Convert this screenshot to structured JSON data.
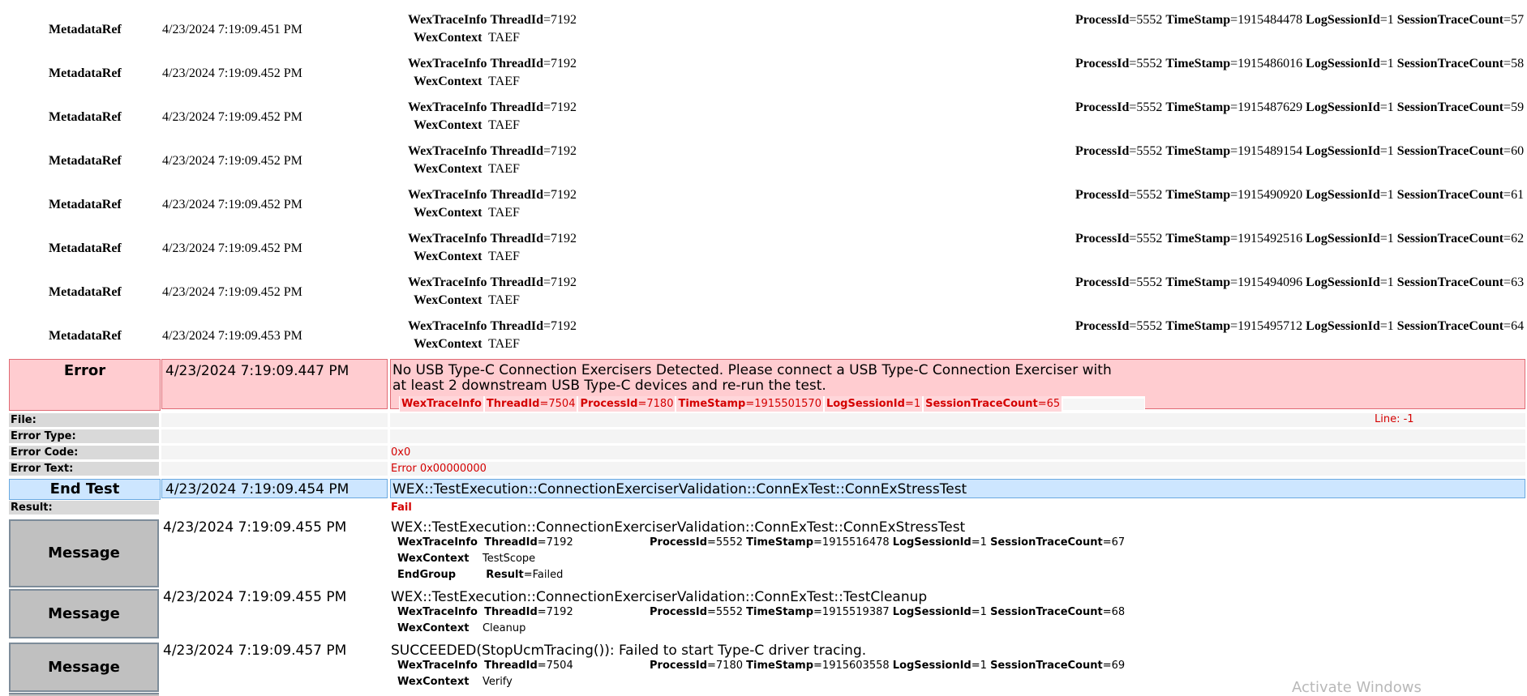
{
  "metadata_rows": [
    {
      "label": "MetadataRef",
      "time": "4/23/2024 7:19:09.451 PM",
      "wti_key": "WexTraceInfo",
      "thread_key": "ThreadId",
      "thread_val": "=7192",
      "ctx_key": "WexContext",
      "ctx_val": "TAEF",
      "pid_key": "ProcessId",
      "pid_val": "=5552",
      "ts_key": "TimeStamp",
      "ts_val": "=1915484478",
      "ls_key": "LogSessionId",
      "ls_val": "=1",
      "stc_key": "SessionTraceCount",
      "stc_val": "=57"
    },
    {
      "label": "MetadataRef",
      "time": "4/23/2024 7:19:09.452 PM",
      "wti_key": "WexTraceInfo",
      "thread_key": "ThreadId",
      "thread_val": "=7192",
      "ctx_key": "WexContext",
      "ctx_val": "TAEF",
      "pid_key": "ProcessId",
      "pid_val": "=5552",
      "ts_key": "TimeStamp",
      "ts_val": "=1915486016",
      "ls_key": "LogSessionId",
      "ls_val": "=1",
      "stc_key": "SessionTraceCount",
      "stc_val": "=58"
    },
    {
      "label": "MetadataRef",
      "time": "4/23/2024 7:19:09.452 PM",
      "wti_key": "WexTraceInfo",
      "thread_key": "ThreadId",
      "thread_val": "=7192",
      "ctx_key": "WexContext",
      "ctx_val": "TAEF",
      "pid_key": "ProcessId",
      "pid_val": "=5552",
      "ts_key": "TimeStamp",
      "ts_val": "=1915487629",
      "ls_key": "LogSessionId",
      "ls_val": "=1",
      "stc_key": "SessionTraceCount",
      "stc_val": "=59"
    },
    {
      "label": "MetadataRef",
      "time": "4/23/2024 7:19:09.452 PM",
      "wti_key": "WexTraceInfo",
      "thread_key": "ThreadId",
      "thread_val": "=7192",
      "ctx_key": "WexContext",
      "ctx_val": "TAEF",
      "pid_key": "ProcessId",
      "pid_val": "=5552",
      "ts_key": "TimeStamp",
      "ts_val": "=1915489154",
      "ls_key": "LogSessionId",
      "ls_val": "=1",
      "stc_key": "SessionTraceCount",
      "stc_val": "=60"
    },
    {
      "label": "MetadataRef",
      "time": "4/23/2024 7:19:09.452 PM",
      "wti_key": "WexTraceInfo",
      "thread_key": "ThreadId",
      "thread_val": "=7192",
      "ctx_key": "WexContext",
      "ctx_val": "TAEF",
      "pid_key": "ProcessId",
      "pid_val": "=5552",
      "ts_key": "TimeStamp",
      "ts_val": "=1915490920",
      "ls_key": "LogSessionId",
      "ls_val": "=1",
      "stc_key": "SessionTraceCount",
      "stc_val": "=61"
    },
    {
      "label": "MetadataRef",
      "time": "4/23/2024 7:19:09.452 PM",
      "wti_key": "WexTraceInfo",
      "thread_key": "ThreadId",
      "thread_val": "=7192",
      "ctx_key": "WexContext",
      "ctx_val": "TAEF",
      "pid_key": "ProcessId",
      "pid_val": "=5552",
      "ts_key": "TimeStamp",
      "ts_val": "=1915492516",
      "ls_key": "LogSessionId",
      "ls_val": "=1",
      "stc_key": "SessionTraceCount",
      "stc_val": "=62"
    },
    {
      "label": "MetadataRef",
      "time": "4/23/2024 7:19:09.452 PM",
      "wti_key": "WexTraceInfo",
      "thread_key": "ThreadId",
      "thread_val": "=7192",
      "ctx_key": "WexContext",
      "ctx_val": "TAEF",
      "pid_key": "ProcessId",
      "pid_val": "=5552",
      "ts_key": "TimeStamp",
      "ts_val": "=1915494096",
      "ls_key": "LogSessionId",
      "ls_val": "=1",
      "stc_key": "SessionTraceCount",
      "stc_val": "=63"
    },
    {
      "label": "MetadataRef",
      "time": "4/23/2024 7:19:09.453 PM",
      "wti_key": "WexTraceInfo",
      "thread_key": "ThreadId",
      "thread_val": "=7192",
      "ctx_key": "WexContext",
      "ctx_val": "TAEF",
      "pid_key": "ProcessId",
      "pid_val": "=5552",
      "ts_key": "TimeStamp",
      "ts_val": "=1915495712",
      "ls_key": "LogSessionId",
      "ls_val": "=1",
      "stc_key": "SessionTraceCount",
      "stc_val": "=64"
    }
  ],
  "error": {
    "label": "Error",
    "time": "4/23/2024 7:19:09.447 PM",
    "message": "No USB Type-C Connection Exercisers Detected. Please connect a USB Type-C Connection Exerciser with at least 2 downstream USB Type-C devices and re-run the test.",
    "trace": {
      "wti": "WexTraceInfo",
      "thread_key": "ThreadId",
      "thread_val": "=7504",
      "pid_key": "ProcessId",
      "pid_val": "=7180",
      "ts_key": "TimeStamp",
      "ts_val": "=1915501570",
      "ls_key": "LogSessionId",
      "ls_val": "=1",
      "stc_key": "SessionTraceCount",
      "stc_val": "=65"
    },
    "file_label": "File:",
    "line_text": "Line: -1",
    "type_label": "Error Type:",
    "code_label": "Error Code:",
    "code_value": "0x0",
    "text_label": "Error Text:",
    "text_value": "Error 0x00000000"
  },
  "end_test": {
    "label": "End Test",
    "time": "4/23/2024 7:19:09.454 PM",
    "name": "WEX::TestExecution::ConnectionExerciserValidation::ConnExTest::ConnExStressTest",
    "result_label": "Result:",
    "result_value": "Fail"
  },
  "messages": [
    {
      "label": "Message",
      "time": "4/23/2024 7:19:09.455 PM",
      "title": "WEX::TestExecution::ConnectionExerciserValidation::ConnExTest::ConnExStressTest",
      "wti": "WexTraceInfo",
      "thread_key": "ThreadId",
      "thread_val": "=7192",
      "pid_key": "ProcessId",
      "pid_val": "=5552",
      "ts_key": "TimeStamp",
      "ts_val": "=1915516478",
      "ls_key": "LogSessionId",
      "ls_val": "=1",
      "stc_key": "SessionTraceCount",
      "stc_val": "=67",
      "ctx_key": "WexContext",
      "ctx_val": "TestScope",
      "extra_key": "EndGroup",
      "extra_sub_key": "Result",
      "extra_sub_val": "=Failed"
    },
    {
      "label": "Message",
      "time": "4/23/2024 7:19:09.455 PM",
      "title": "WEX::TestExecution::ConnectionExerciserValidation::ConnExTest::TestCleanup",
      "wti": "WexTraceInfo",
      "thread_key": "ThreadId",
      "thread_val": "=7192",
      "pid_key": "ProcessId",
      "pid_val": "=5552",
      "ts_key": "TimeStamp",
      "ts_val": "=1915519387",
      "ls_key": "LogSessionId",
      "ls_val": "=1",
      "stc_key": "SessionTraceCount",
      "stc_val": "=68",
      "ctx_key": "WexContext",
      "ctx_val": "Cleanup"
    },
    {
      "label": "Message",
      "time": "4/23/2024 7:19:09.457 PM",
      "title": "SUCCEEDED(StopUcmTracing()): Failed to start Type-C driver tracing.",
      "wti": "WexTraceInfo",
      "thread_key": "ThreadId",
      "thread_val": "=7504",
      "pid_key": "ProcessId",
      "pid_val": "=7180",
      "ts_key": "TimeStamp",
      "ts_val": "=1915603558",
      "ls_key": "LogSessionId",
      "ls_val": "=1",
      "stc_key": "SessionTraceCount",
      "stc_val": "=69",
      "ctx_key": "WexContext",
      "ctx_val": "Verify"
    }
  ],
  "watermark": "Activate Windows"
}
